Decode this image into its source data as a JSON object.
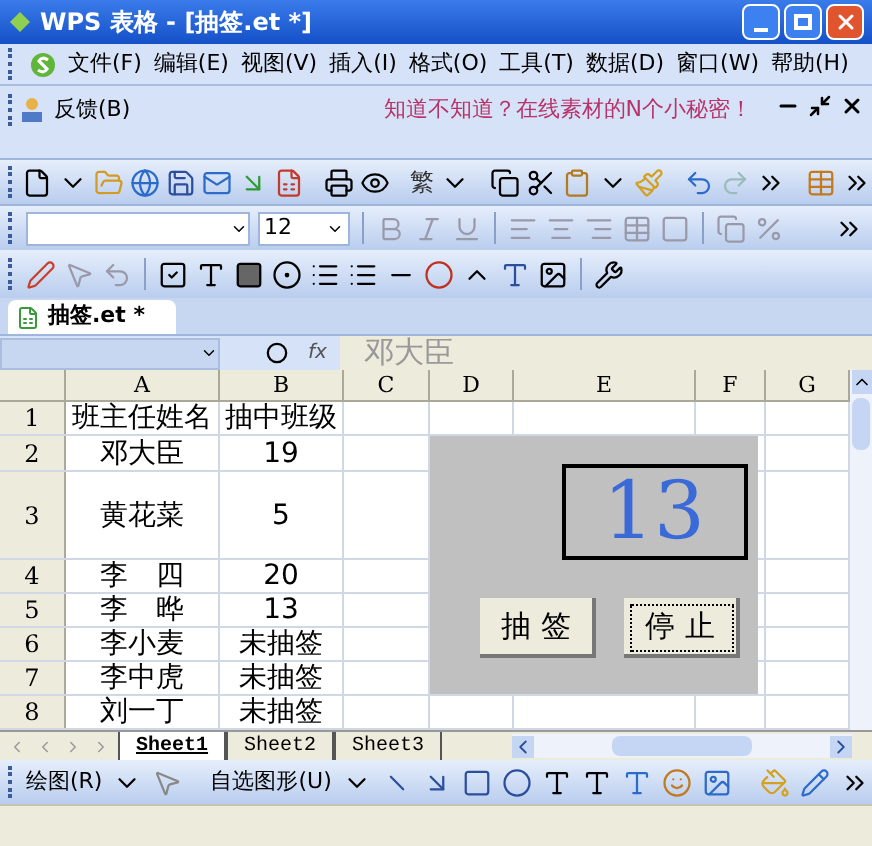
{
  "window": {
    "title": "WPS 表格 - [抽签.et *]"
  },
  "menu": [
    "文件(F)",
    "编辑(E)",
    "视图(V)",
    "插入(I)",
    "格式(O)",
    "工具(T)",
    "数据(D)",
    "窗口(W)",
    "帮助(H)"
  ],
  "feedback": {
    "label": "反馈(B)",
    "promo": "知道不知道？在线素材的N个小秘密！"
  },
  "toolbar": {
    "convert_label": "繁",
    "font_size": "12"
  },
  "document_tab": {
    "label": "抽签.et *",
    "selected": true
  },
  "formula_bar": {
    "function_label": "fx",
    "value": "邓大臣"
  },
  "columns": [
    "A",
    "B",
    "C",
    "D",
    "E",
    "F",
    "G"
  ],
  "rows": [
    {
      "number": "1",
      "cells": [
        "班主任姓名",
        "抽中班级"
      ]
    },
    {
      "number": "2",
      "cells": [
        "邓大臣",
        "19"
      ]
    },
    {
      "number": "3",
      "cells": [
        "黄花菜",
        "5"
      ]
    },
    {
      "number": "4",
      "cells": [
        "李　四",
        "20"
      ]
    },
    {
      "number": "5",
      "cells": [
        "李　晔",
        "13"
      ]
    },
    {
      "number": "6",
      "cells": [
        "李小麦",
        "未抽签"
      ]
    },
    {
      "number": "7",
      "cells": [
        "李中虎",
        "未抽签"
      ]
    },
    {
      "number": "8",
      "cells": [
        "刘一丁",
        "未抽签"
      ]
    }
  ],
  "lottery_panel": {
    "display": "13",
    "buttons": [
      {
        "label": "抽 签",
        "focused": false
      },
      {
        "label": "停 止",
        "focused": true
      }
    ]
  },
  "sheet_tabs": [
    {
      "label": "Sheet1",
      "selected": true
    },
    {
      "label": "Sheet2",
      "selected": false
    },
    {
      "label": "Sheet3",
      "selected": false
    }
  ],
  "drawing_toolbar": {
    "draw_label": "绘图(R)",
    "autoshape_label": "自选图形(U)"
  }
}
